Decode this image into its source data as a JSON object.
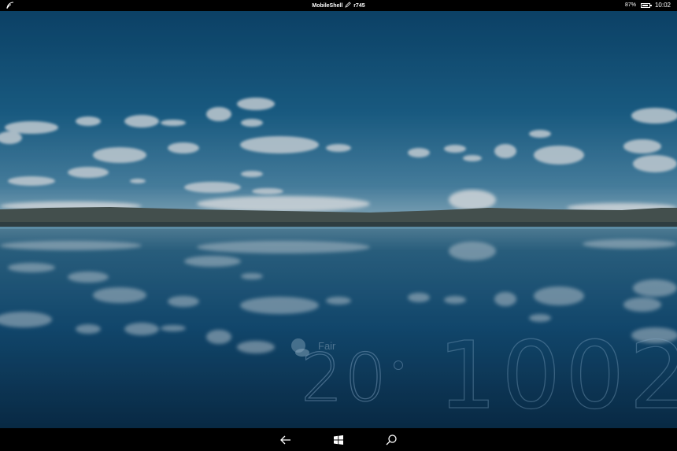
{
  "status_bar": {
    "title": "MobileShell",
    "build": "r745",
    "battery_percent": "87%",
    "battery_level": 0.87,
    "time": "10:02"
  },
  "lock_screen": {
    "weather_condition": "Fair",
    "temperature": "20",
    "clock": "1002"
  },
  "nav_bar": {
    "icons": [
      "back-arrow-icon",
      "windows-logo-icon",
      "search-icon"
    ]
  },
  "colors": {
    "sky_top": "#0e4f7a",
    "sky_horizon": "#6a9dba",
    "water": "#0d3f63",
    "bars": "#000000"
  }
}
